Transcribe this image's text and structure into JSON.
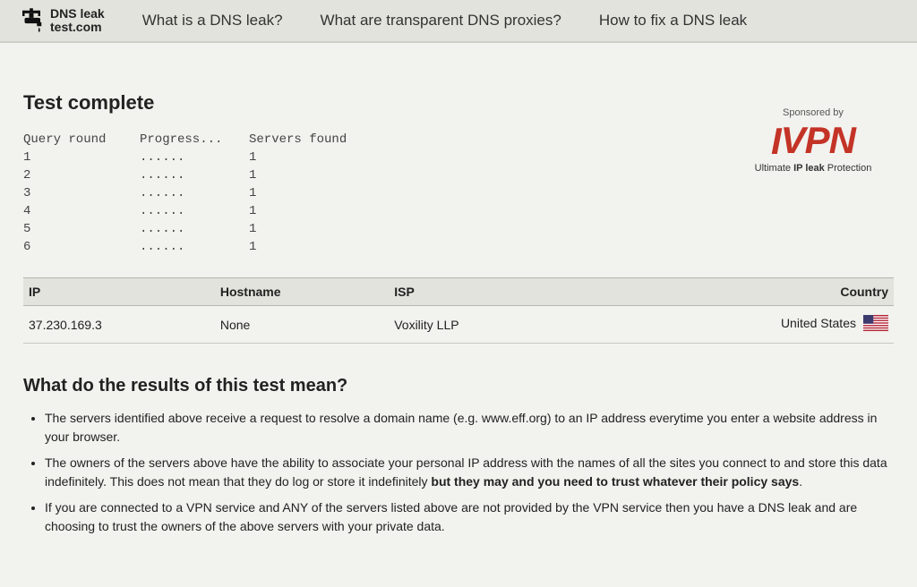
{
  "brand": {
    "line1": "DNS leak",
    "line2": "test.com"
  },
  "nav": [
    {
      "label": "What is a DNS leak?"
    },
    {
      "label": "What are transparent DNS proxies?"
    },
    {
      "label": "How to fix a DNS leak"
    }
  ],
  "title": "Test complete",
  "query_headers": {
    "round": "Query round",
    "progress": "Progress...",
    "servers": "Servers found"
  },
  "query_rows": [
    {
      "round": "1",
      "progress": "......",
      "servers": "1"
    },
    {
      "round": "2",
      "progress": "......",
      "servers": "1"
    },
    {
      "round": "3",
      "progress": "......",
      "servers": "1"
    },
    {
      "round": "4",
      "progress": "......",
      "servers": "1"
    },
    {
      "round": "5",
      "progress": "......",
      "servers": "1"
    },
    {
      "round": "6",
      "progress": "......",
      "servers": "1"
    }
  ],
  "results_headers": {
    "ip": "IP",
    "hostname": "Hostname",
    "isp": "ISP",
    "country": "Country"
  },
  "results_rows": [
    {
      "ip": "37.230.169.3",
      "hostname": "None",
      "isp": "Voxility LLP",
      "country": "United States",
      "flag": "us"
    }
  ],
  "sponsor": {
    "sponsored_by": "Sponsored by",
    "logo": "IVPN",
    "tagline_prefix": "Ultimate ",
    "tagline_bold": "IP leak",
    "tagline_suffix": " Protection"
  },
  "results_heading": "What do the results of this test mean?",
  "explain": {
    "item1": "The servers identified above receive a request to resolve a domain name (e.g. www.eff.org) to an IP address everytime you enter a website address in your browser.",
    "item2_prefix": "The owners of the servers above have the ability to associate your personal IP address with the names of all the sites you connect to and store this data indefinitely. This does not mean that they do log or store it indefinitely ",
    "item2_bold": "but they may and you need to trust whatever their policy says",
    "item2_suffix": ".",
    "item3": "If you are connected to a VPN service and ANY of the servers listed above are not provided by the VPN service then you have a DNS leak and are choosing to trust the owners of the above servers with your private data."
  }
}
